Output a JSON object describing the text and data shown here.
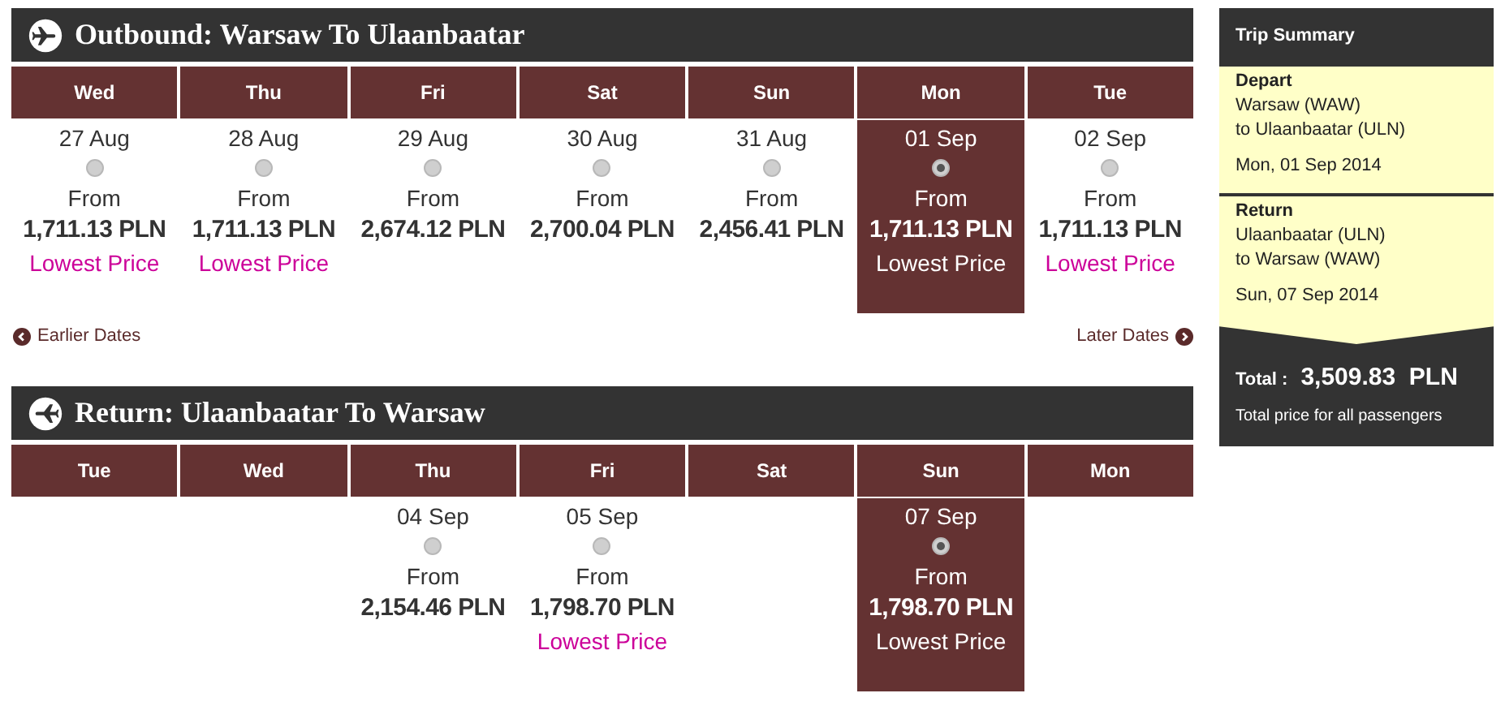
{
  "outbound": {
    "title": "Outbound: Warsaw To Ulaanbaatar",
    "days": [
      {
        "day": "Wed",
        "date": "27 Aug",
        "from": "From",
        "price": "1,711.13 PLN",
        "note": "Lowest Price",
        "selected": false
      },
      {
        "day": "Thu",
        "date": "28 Aug",
        "from": "From",
        "price": "1,711.13 PLN",
        "note": "Lowest Price",
        "selected": false
      },
      {
        "day": "Fri",
        "date": "29 Aug",
        "from": "From",
        "price": "2,674.12 PLN",
        "selected": false
      },
      {
        "day": "Sat",
        "date": "30 Aug",
        "from": "From",
        "price": "2,700.04 PLN",
        "selected": false
      },
      {
        "day": "Sun",
        "date": "31 Aug",
        "from": "From",
        "price": "2,456.41 PLN",
        "selected": false
      },
      {
        "day": "Mon",
        "date": "01 Sep",
        "from": "From",
        "price": "1,711.13 PLN",
        "note": "Lowest Price",
        "selected": true
      },
      {
        "day": "Tue",
        "date": "02 Sep",
        "from": "From",
        "price": "1,711.13 PLN",
        "note": "Lowest Price",
        "selected": false
      }
    ],
    "earlier": "Earlier Dates",
    "later": "Later Dates"
  },
  "return": {
    "title": "Return: Ulaanbaatar To Warsaw",
    "days": [
      {
        "day": "Tue"
      },
      {
        "day": "Wed"
      },
      {
        "day": "Thu",
        "date": "04 Sep",
        "from": "From",
        "price": "2,154.46 PLN",
        "selected": false
      },
      {
        "day": "Fri",
        "date": "05 Sep",
        "from": "From",
        "price": "1,798.70 PLN",
        "note": "Lowest Price",
        "selected": false
      },
      {
        "day": "Sat"
      },
      {
        "day": "Sun",
        "date": "07 Sep",
        "from": "From",
        "price": "1,798.70 PLN",
        "note": "Lowest Price",
        "selected": true
      },
      {
        "day": "Mon"
      }
    ]
  },
  "summary": {
    "title": "Trip Summary",
    "legs": [
      {
        "label": "Depart",
        "lines": [
          "Warsaw (WAW)",
          "to Ulaanbaatar (ULN)"
        ],
        "date": "Mon, 01 Sep 2014"
      },
      {
        "label": "Return",
        "lines": [
          "Ulaanbaatar (ULN)",
          "to Warsaw (WAW)"
        ],
        "date": "Sun, 07 Sep 2014"
      }
    ],
    "total_label": "Total :",
    "total": "3,509.83  PLN",
    "note": "Total price for all passengers"
  }
}
